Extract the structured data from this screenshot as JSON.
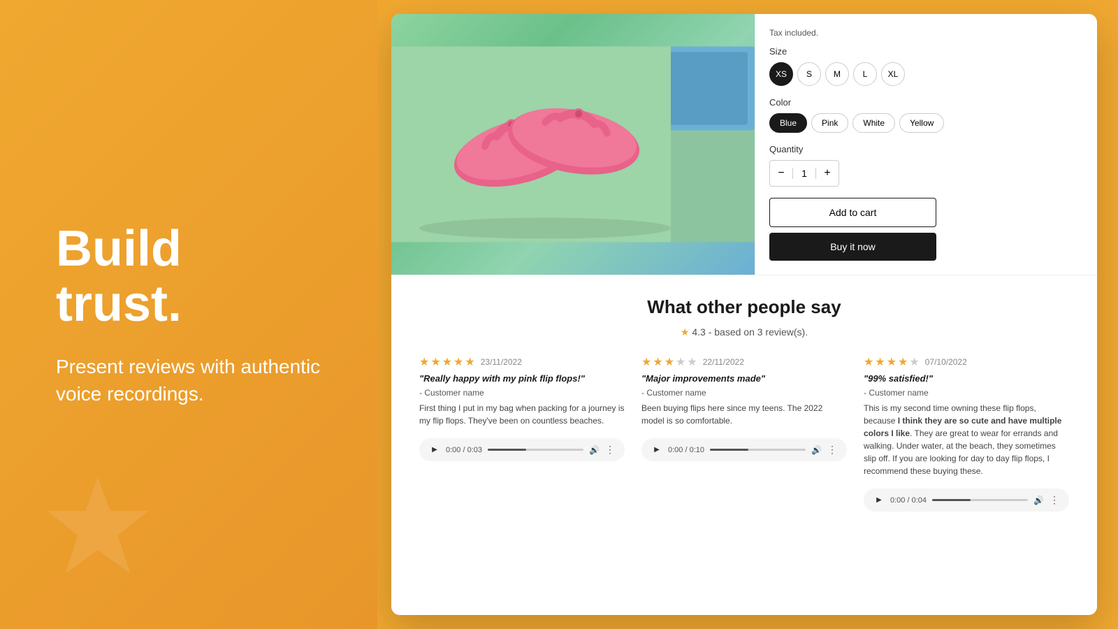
{
  "left": {
    "headline_line1": "Build",
    "headline_line2": "trust.",
    "description": "Present reviews with authentic voice recordings."
  },
  "product": {
    "tax_label": "Tax included.",
    "size_label": "Size",
    "sizes": [
      "XS",
      "S",
      "M",
      "L",
      "XL"
    ],
    "active_size": "XS",
    "color_label": "Color",
    "colors": [
      "Blue",
      "Pink",
      "White",
      "Yellow"
    ],
    "active_color": "Blue",
    "qty_label": "Quantity",
    "qty_value": "1",
    "qty_minus": "−",
    "qty_plus": "+",
    "add_to_cart": "Add to cart",
    "buy_now": "Buy it now"
  },
  "reviews": {
    "section_title": "What other people say",
    "overall_rating": "4.3 - based on 3 review(s).",
    "items": [
      {
        "stars_filled": 5,
        "stars_empty": 0,
        "date": "23/11/2022",
        "title": "\"Really happy with my pink flip flops!\"",
        "author": "- Customer name",
        "text": "First thing I put in my bag when packing for a journey is my flip flops. They've been on countless beaches.",
        "audio_time": "0:00 / 0:03"
      },
      {
        "stars_filled": 3,
        "stars_empty": 2,
        "date": "22/11/2022",
        "title": "\"Major improvements made\"",
        "author": "- Customer name",
        "text": "Been buying flips here since my teens. The 2022 model is so comfortable.",
        "audio_time": "0:00 / 0:10"
      },
      {
        "stars_filled": 4,
        "stars_empty": 1,
        "date": "07/10/2022",
        "title": "\"99% satisfied!\"",
        "author": "- Customer name",
        "text": "This is my second time owning these flip flops, because I think they are so cute and have multiple colors I like. They are great to wear for errands and walking. Under water, at the beach, they sometimes slip off. If you are looking for day to day flip flops, I recommend these buying these.",
        "audio_time": "0:00 / 0:04"
      }
    ]
  }
}
